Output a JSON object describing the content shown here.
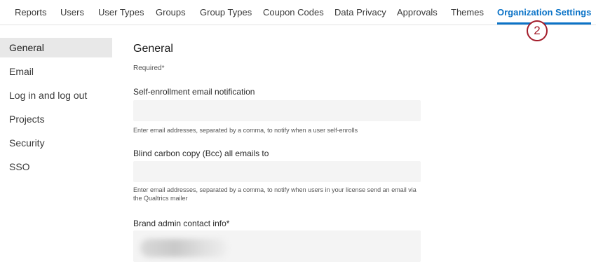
{
  "top_nav": {
    "tabs": [
      {
        "label": "Reports"
      },
      {
        "label": "Users"
      },
      {
        "label": "User Types"
      },
      {
        "label": "Groups"
      },
      {
        "label": "Group Types"
      },
      {
        "label": "Coupon Codes"
      },
      {
        "label": "Data Privacy"
      },
      {
        "label": "Approvals"
      },
      {
        "label": "Themes"
      },
      {
        "label": "Organization Settings",
        "active": true
      }
    ],
    "accent_color": "#0b73c7"
  },
  "callout": {
    "number": "2",
    "color": "#a31c2a"
  },
  "sidebar": {
    "items": [
      {
        "label": "General",
        "active": true
      },
      {
        "label": "Email"
      },
      {
        "label": "Log in and log out"
      },
      {
        "label": "Projects"
      },
      {
        "label": "Security"
      },
      {
        "label": "SSO"
      }
    ]
  },
  "main": {
    "title": "General",
    "required_note": "Required*",
    "fields": [
      {
        "label": "Self-enrollment email notification",
        "value": "",
        "hint": "Enter email addresses, separated by a comma, to notify when a user self-enrolls"
      },
      {
        "label": "Blind carbon copy (Bcc) all emails to",
        "value": "",
        "hint": "Enter email addresses, separated by a comma, to notify when users in your license send an email via the Qualtrics mailer"
      },
      {
        "label": "Brand admin contact info*",
        "value": "",
        "value_blurred": true
      }
    ]
  }
}
